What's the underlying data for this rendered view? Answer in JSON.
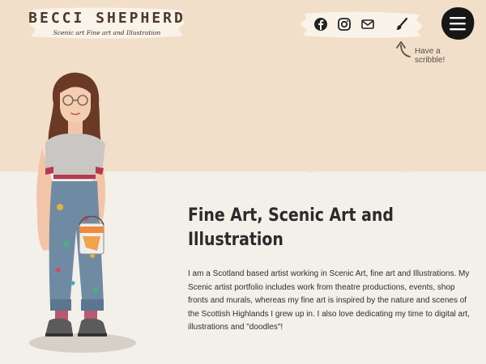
{
  "header": {
    "logo_name": "BECCI SHEPHERD",
    "logo_tagline": "Scenic art Fine art and Illustration",
    "social_icons": [
      "facebook-icon",
      "instagram-icon",
      "mail-icon",
      "paintbrush-icon"
    ],
    "menu_icon": "hamburger-menu-icon",
    "scribble_hint": "Have a scribble!"
  },
  "hero": {
    "heading": "Fine Art, Scenic Art and Illustration",
    "intro": "I am a Scotland based artist working in Scenic Art, fine art and Illustrations. My Scenic artist portfolio includes work from theatre productions, events, shop fronts and murals, whereas my fine art is inspired by the nature and scenes of the Scottish Highlands I grew up in. I also love dedicating my time to digital art, illustrations and \"doodles\"!"
  },
  "colors": {
    "top_band": "#f1dfc9",
    "page_background": "#f3efe9",
    "brush_stroke": "#faf3ea",
    "text": "#2b2b2b"
  }
}
